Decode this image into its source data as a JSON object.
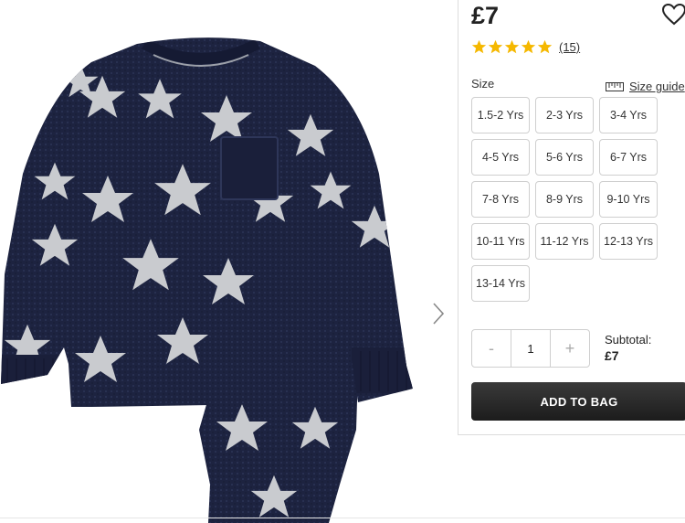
{
  "product": {
    "price": "£7",
    "rating": 5,
    "review_count": "(15)"
  },
  "colors": {
    "star_fill": "#F5B800",
    "button_bg": "#222222",
    "navy": "#1d2340",
    "pattern_star": "#c9cbcf"
  },
  "icons": {
    "wishlist": "heart-outline-icon",
    "size_guide": "ruler-icon",
    "next": "chevron-right-icon"
  },
  "size": {
    "label": "Size",
    "guide_label": "Size guide",
    "options": [
      "1.5-2 Yrs",
      "2-3 Yrs",
      "3-4 Yrs",
      "4-5 Yrs",
      "5-6 Yrs",
      "6-7 Yrs",
      "7-8 Yrs",
      "8-9 Yrs",
      "9-10 Yrs",
      "10-11 Yrs",
      "11-12 Yrs",
      "12-13 Yrs",
      "13-14 Yrs"
    ]
  },
  "quantity": {
    "minus": "-",
    "value": "1",
    "plus": "+"
  },
  "subtotal": {
    "label": "Subtotal:",
    "value": "£7"
  },
  "cta": {
    "add_to_bag": "ADD TO BAG"
  }
}
